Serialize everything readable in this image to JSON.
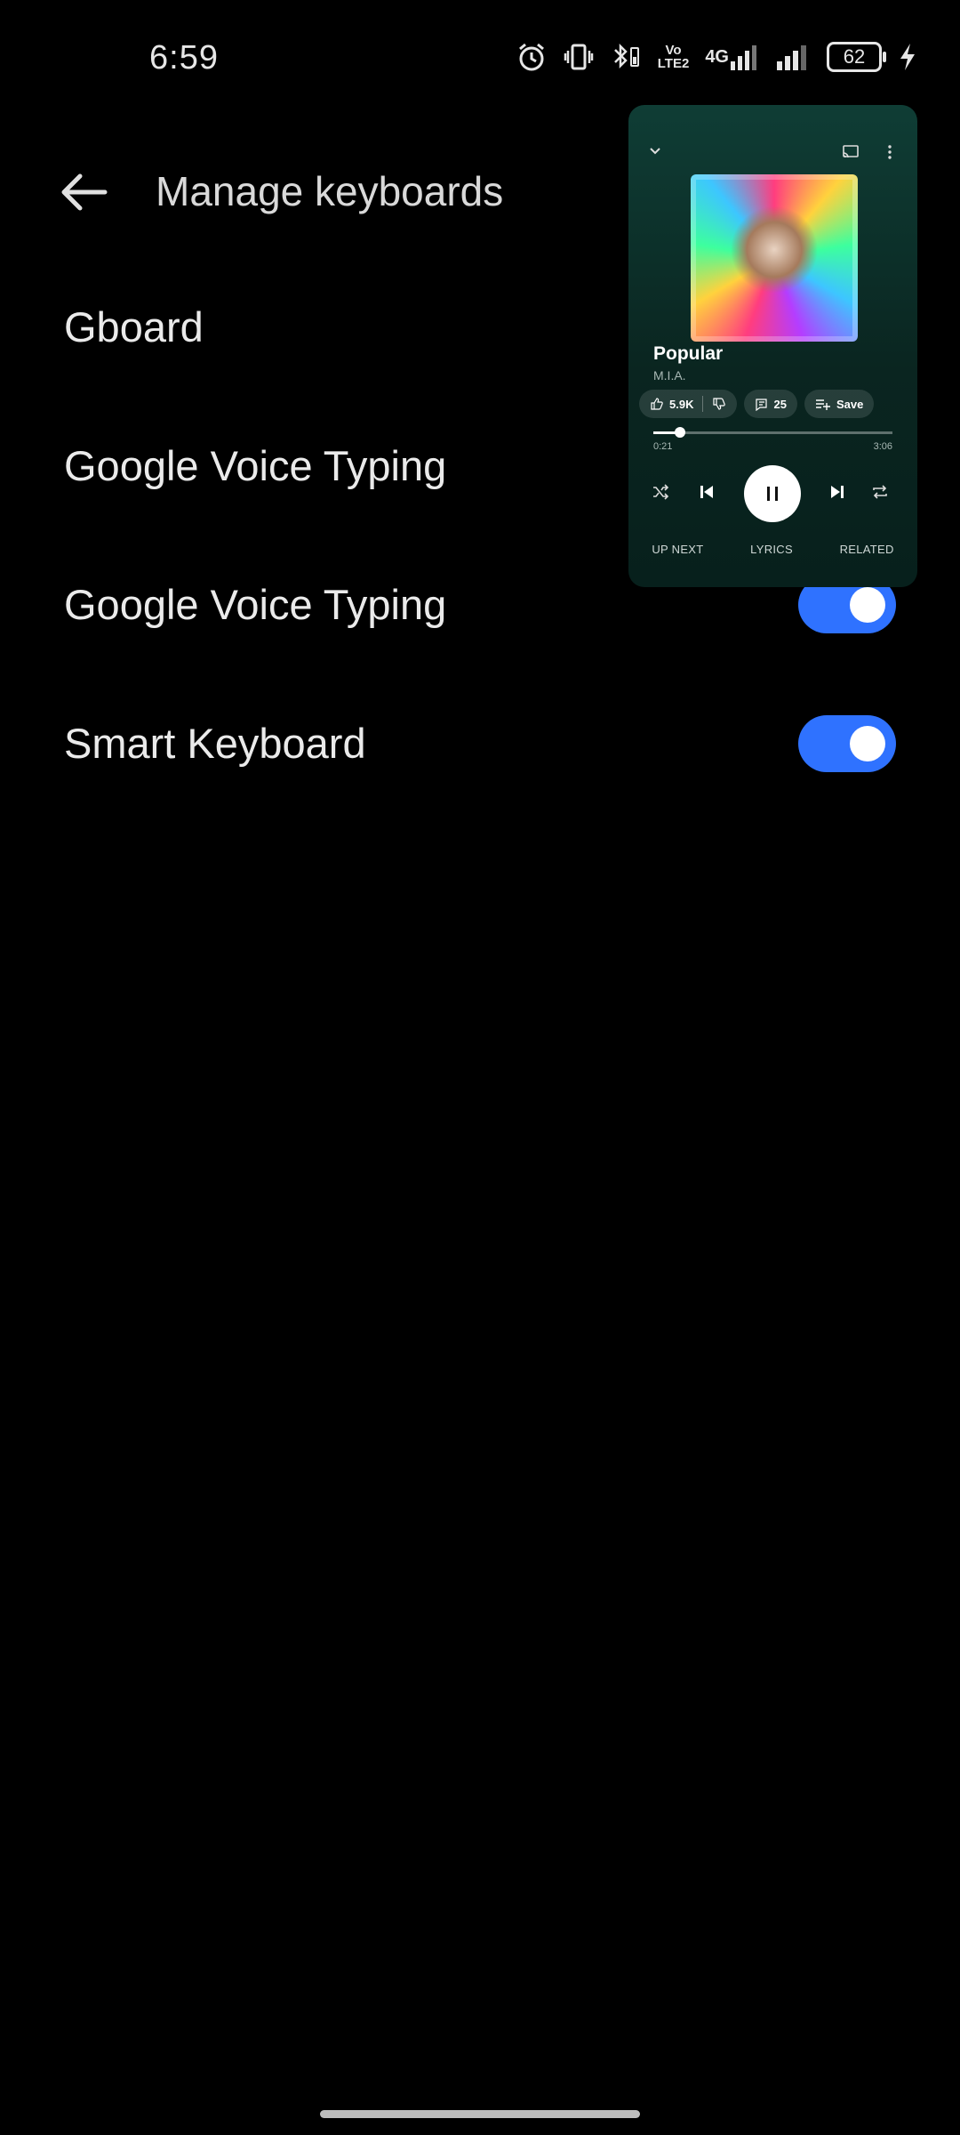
{
  "status_bar": {
    "time": "6:59",
    "battery_level": "62",
    "network_label": "4G",
    "volte_label_top": "Vo",
    "volte_label_bottom": "LTE2"
  },
  "header": {
    "title": "Manage keyboards"
  },
  "keyboards": [
    {
      "label": "Gboard",
      "enabled": null
    },
    {
      "label": "Google Voice Typing",
      "enabled": null
    },
    {
      "label": "Google Voice Typing",
      "enabled": true
    },
    {
      "label": "Smart Keyboard",
      "enabled": true
    }
  ],
  "player": {
    "song_title": "Popular",
    "artist": "M.I.A.",
    "likes": "5.9K",
    "comments": "25",
    "save_label": "Save",
    "current_time": "0:21",
    "total_time": "3:06",
    "progress_fraction": 0.113,
    "tabs": [
      "UP NEXT",
      "LYRICS",
      "RELATED"
    ]
  },
  "colors": {
    "toggle_on": "#2f72ff",
    "background": "#000000",
    "player_bg": "#0f3d35"
  }
}
